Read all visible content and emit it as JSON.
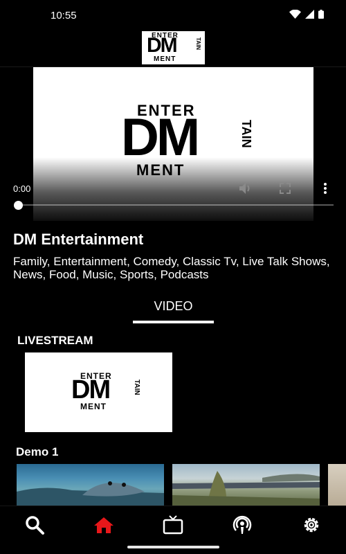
{
  "status_bar": {
    "time": "10:55"
  },
  "header": {
    "logo": {
      "top": "ENTER",
      "main": "DM",
      "side": "TAIN",
      "bottom": "MENT"
    }
  },
  "player": {
    "current_time": "0:00",
    "progress": 0.0
  },
  "channel": {
    "title": "DM Entertainment",
    "description": "Family, Entertainment, Comedy, Classic Tv, Live Talk Shows, News, Food, Music, Sports, Podcasts"
  },
  "tabs": [
    {
      "label": "VIDEO",
      "selected": true
    }
  ],
  "livestream": {
    "title": "LIVESTREAM"
  },
  "demo": {
    "title": "Demo 1"
  },
  "nav": {
    "items": [
      "search",
      "home",
      "tv",
      "podcast",
      "settings"
    ],
    "active": "home",
    "active_color": "#e8171a",
    "inactive_color": "#ffffff"
  },
  "icons": {
    "wifi": "wifi-icon",
    "signal": "signal-icon",
    "battery": "battery-icon",
    "mute": "volume-icon",
    "fullscreen": "fullscreen-icon",
    "more": "more-vert-icon"
  }
}
